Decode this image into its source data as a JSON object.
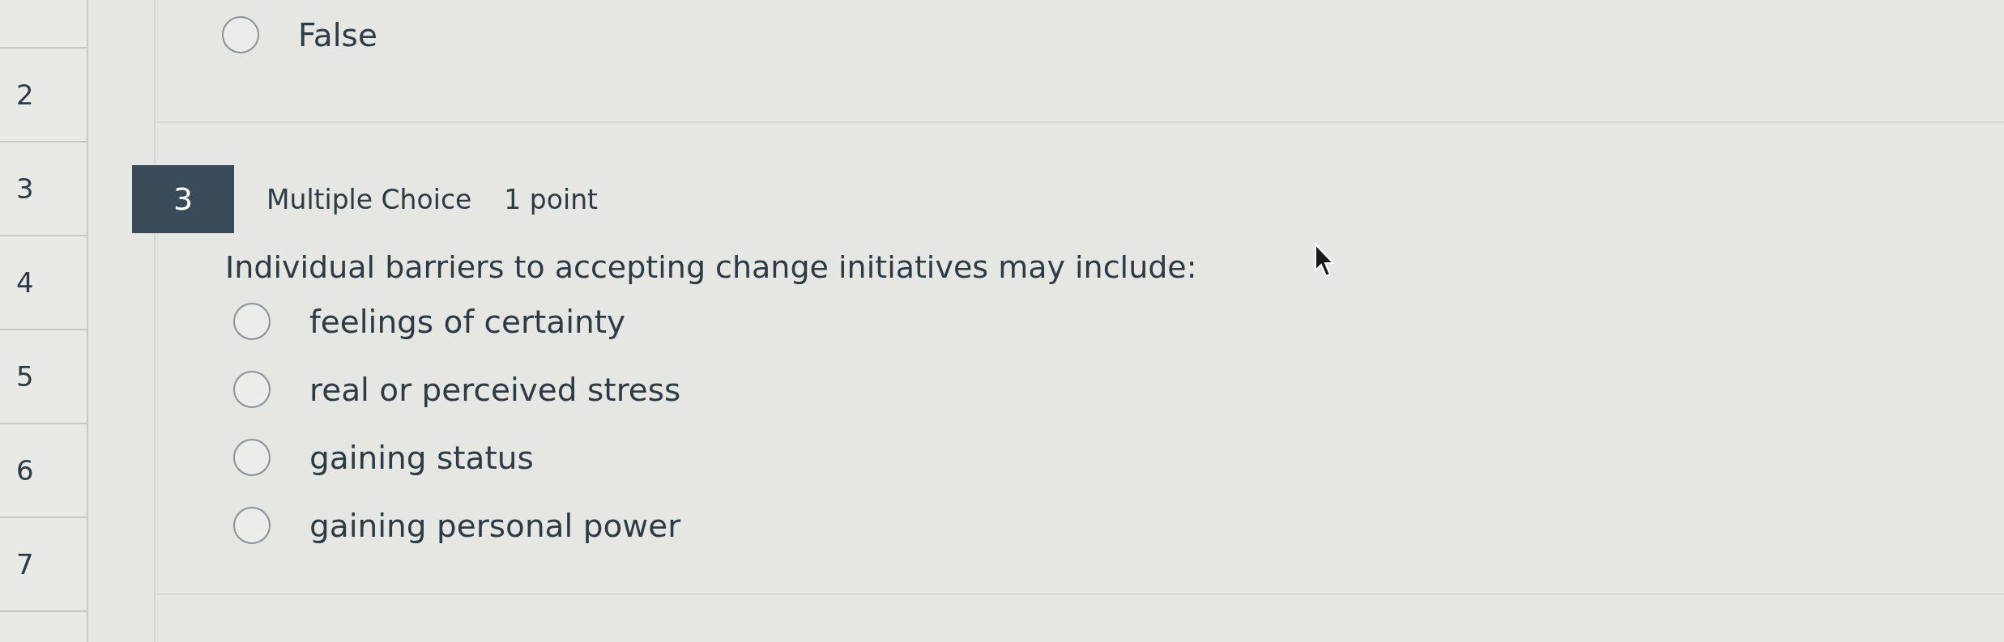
{
  "nav": {
    "items": [
      {
        "label": "2",
        "selected": false
      },
      {
        "label": "3",
        "selected": false
      },
      {
        "label": "4",
        "selected": false
      },
      {
        "label": "5",
        "selected": false
      },
      {
        "label": "6",
        "selected": false
      },
      {
        "label": "7",
        "selected": false
      }
    ]
  },
  "previous_question": {
    "options": [
      {
        "label": "False",
        "selected": false
      }
    ]
  },
  "question": {
    "number": "3",
    "type": "Multiple Choice",
    "points": "1 point",
    "text": "Individual barriers to accepting change initiatives may include:",
    "options": [
      {
        "label": "feelings of certainty",
        "selected": false
      },
      {
        "label": "real or perceived stress",
        "selected": false
      },
      {
        "label": "gaining status",
        "selected": false
      },
      {
        "label": "gaining personal power",
        "selected": false
      }
    ]
  }
}
